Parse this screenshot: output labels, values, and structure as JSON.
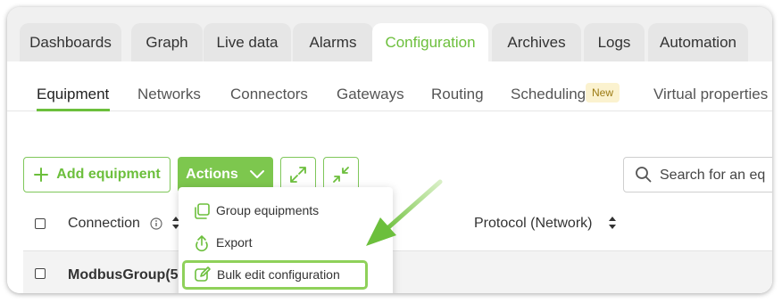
{
  "tabs": [
    "Dashboards",
    "Graph",
    "Live data",
    "Alarms",
    "Configuration",
    "Archives",
    "Logs",
    "Automation"
  ],
  "subnav": {
    "items": [
      "Equipment",
      "Networks",
      "Connectors",
      "Gateways",
      "Routing",
      "Scheduling",
      "Virtual properties"
    ],
    "new_badge": "New"
  },
  "toolbar": {
    "add_label": "Add equipment",
    "actions_label": "Actions",
    "search_placeholder": "Search for an eq"
  },
  "table": {
    "headers": [
      "Connection",
      "Protocol (Network)"
    ],
    "row_name": "ModbusGroup(5"
  },
  "actions_menu": [
    "Group equipments",
    "Export",
    "Bulk edit configuration"
  ],
  "colors": {
    "accent": "#6cbf3c",
    "button_green": "#7dc74e",
    "highlight": "#8fd15a"
  }
}
